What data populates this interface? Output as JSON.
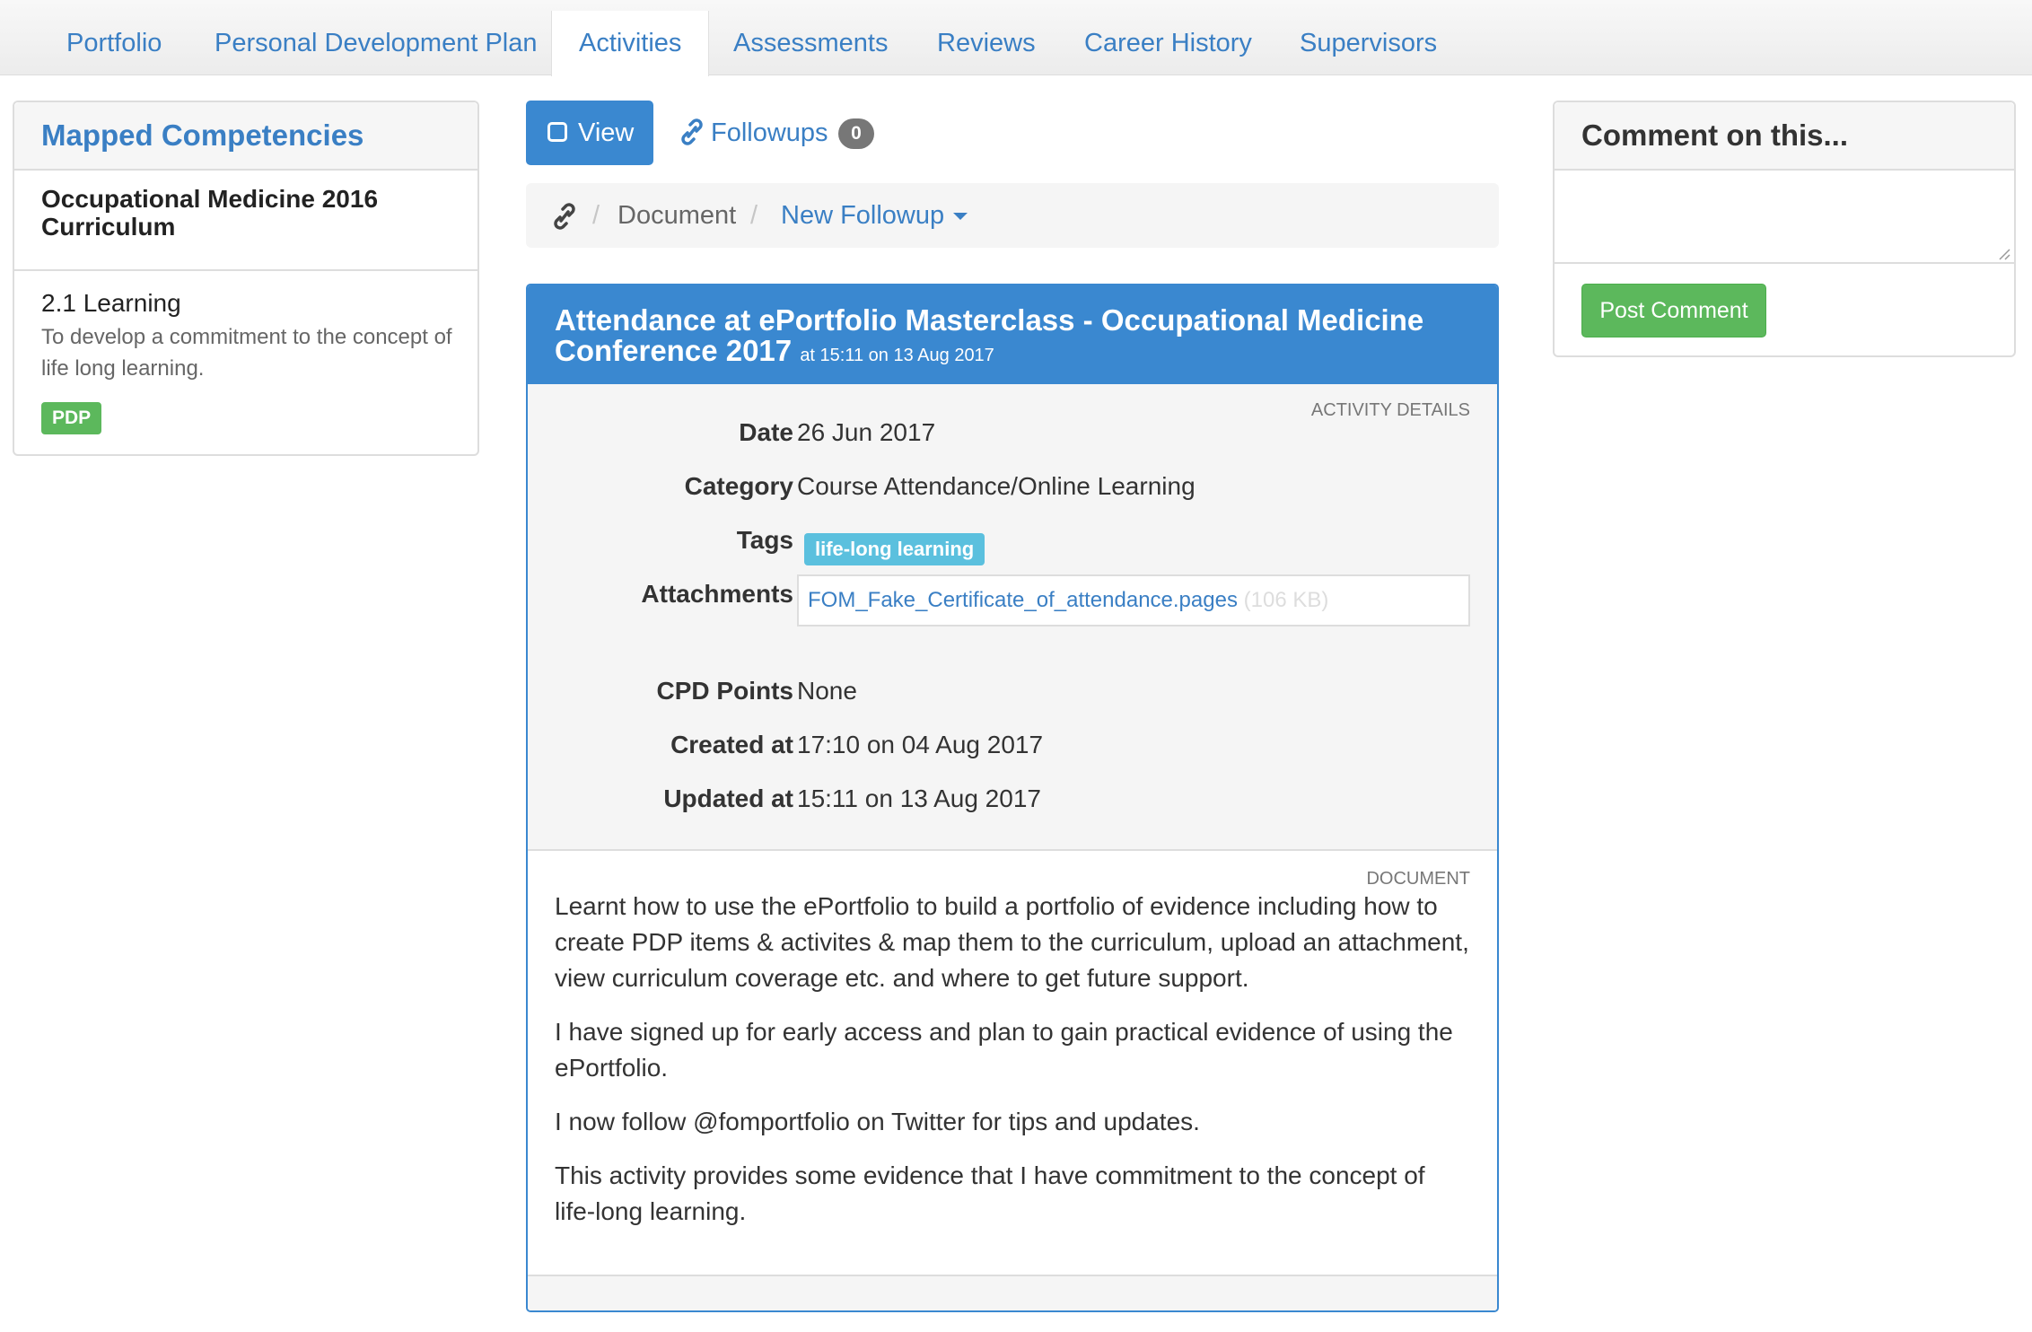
{
  "nav": {
    "tabs": [
      {
        "label": "Portfolio",
        "active": false
      },
      {
        "label": "Personal Development Plan",
        "active": false
      },
      {
        "label": "Activities",
        "active": true
      },
      {
        "label": "Assessments",
        "active": false
      },
      {
        "label": "Reviews",
        "active": false
      },
      {
        "label": "Career History",
        "active": false
      },
      {
        "label": "Supervisors",
        "active": false
      }
    ]
  },
  "left_panel": {
    "title": "Mapped Competencies",
    "curriculum": "Occupational Medicine 2016 Curriculum",
    "competency": {
      "title": "2.1 Learning",
      "description": "To develop a commitment to the concept of life long learning.",
      "badge": "PDP"
    }
  },
  "toolbar": {
    "view_label": "View",
    "followups_label": "Followups",
    "followups_count": "0"
  },
  "breadcrumb": {
    "document_label": "Document",
    "new_followup_label": "New Followup"
  },
  "activity": {
    "title": "Attendance at ePortfolio Masterclass - Occupational Medicine Conference 2017",
    "timestamp": "at 15:11 on 13 Aug 2017",
    "details_label": "ACTIVITY DETAILS",
    "fields": {
      "date_label": "Date",
      "date_value": "26 Jun 2017",
      "category_label": "Category",
      "category_value": "Course Attendance/Online Learning",
      "tags_label": "Tags",
      "tag": "life-long learning",
      "attachments_label": "Attachments",
      "attachment_name": "FOM_Fake_Certificate_of_attendance.pages",
      "attachment_size": "(106 KB)",
      "cpd_label": "CPD Points",
      "cpd_value": "None",
      "created_label": "Created at",
      "created_value": "17:10 on 04 Aug 2017",
      "updated_label": "Updated at",
      "updated_value": "15:11 on 13 Aug 2017"
    },
    "document_label": "DOCUMENT",
    "document_paragraphs": [
      "Learnt how to use the ePortfolio to build a portfolio of evidence including how to create PDP items & activites & map them to the curriculum, upload an attachment, view curriculum coverage etc. and where to get future support.",
      "I have signed up for early access and plan to gain practical evidence of using the ePortfolio.",
      "I now follow @fomportfolio on Twitter for tips and updates.",
      "This activity provides some evidence that I have commitment to the concept of life-long learning."
    ]
  },
  "comment_panel": {
    "title": "Comment on this...",
    "placeholder": "",
    "post_label": "Post Comment"
  },
  "colors": {
    "link": "#3a7fc4",
    "primary": "#3a88d0",
    "success": "#5cb85c",
    "info": "#5bc0de",
    "badge_gray": "#777777"
  }
}
